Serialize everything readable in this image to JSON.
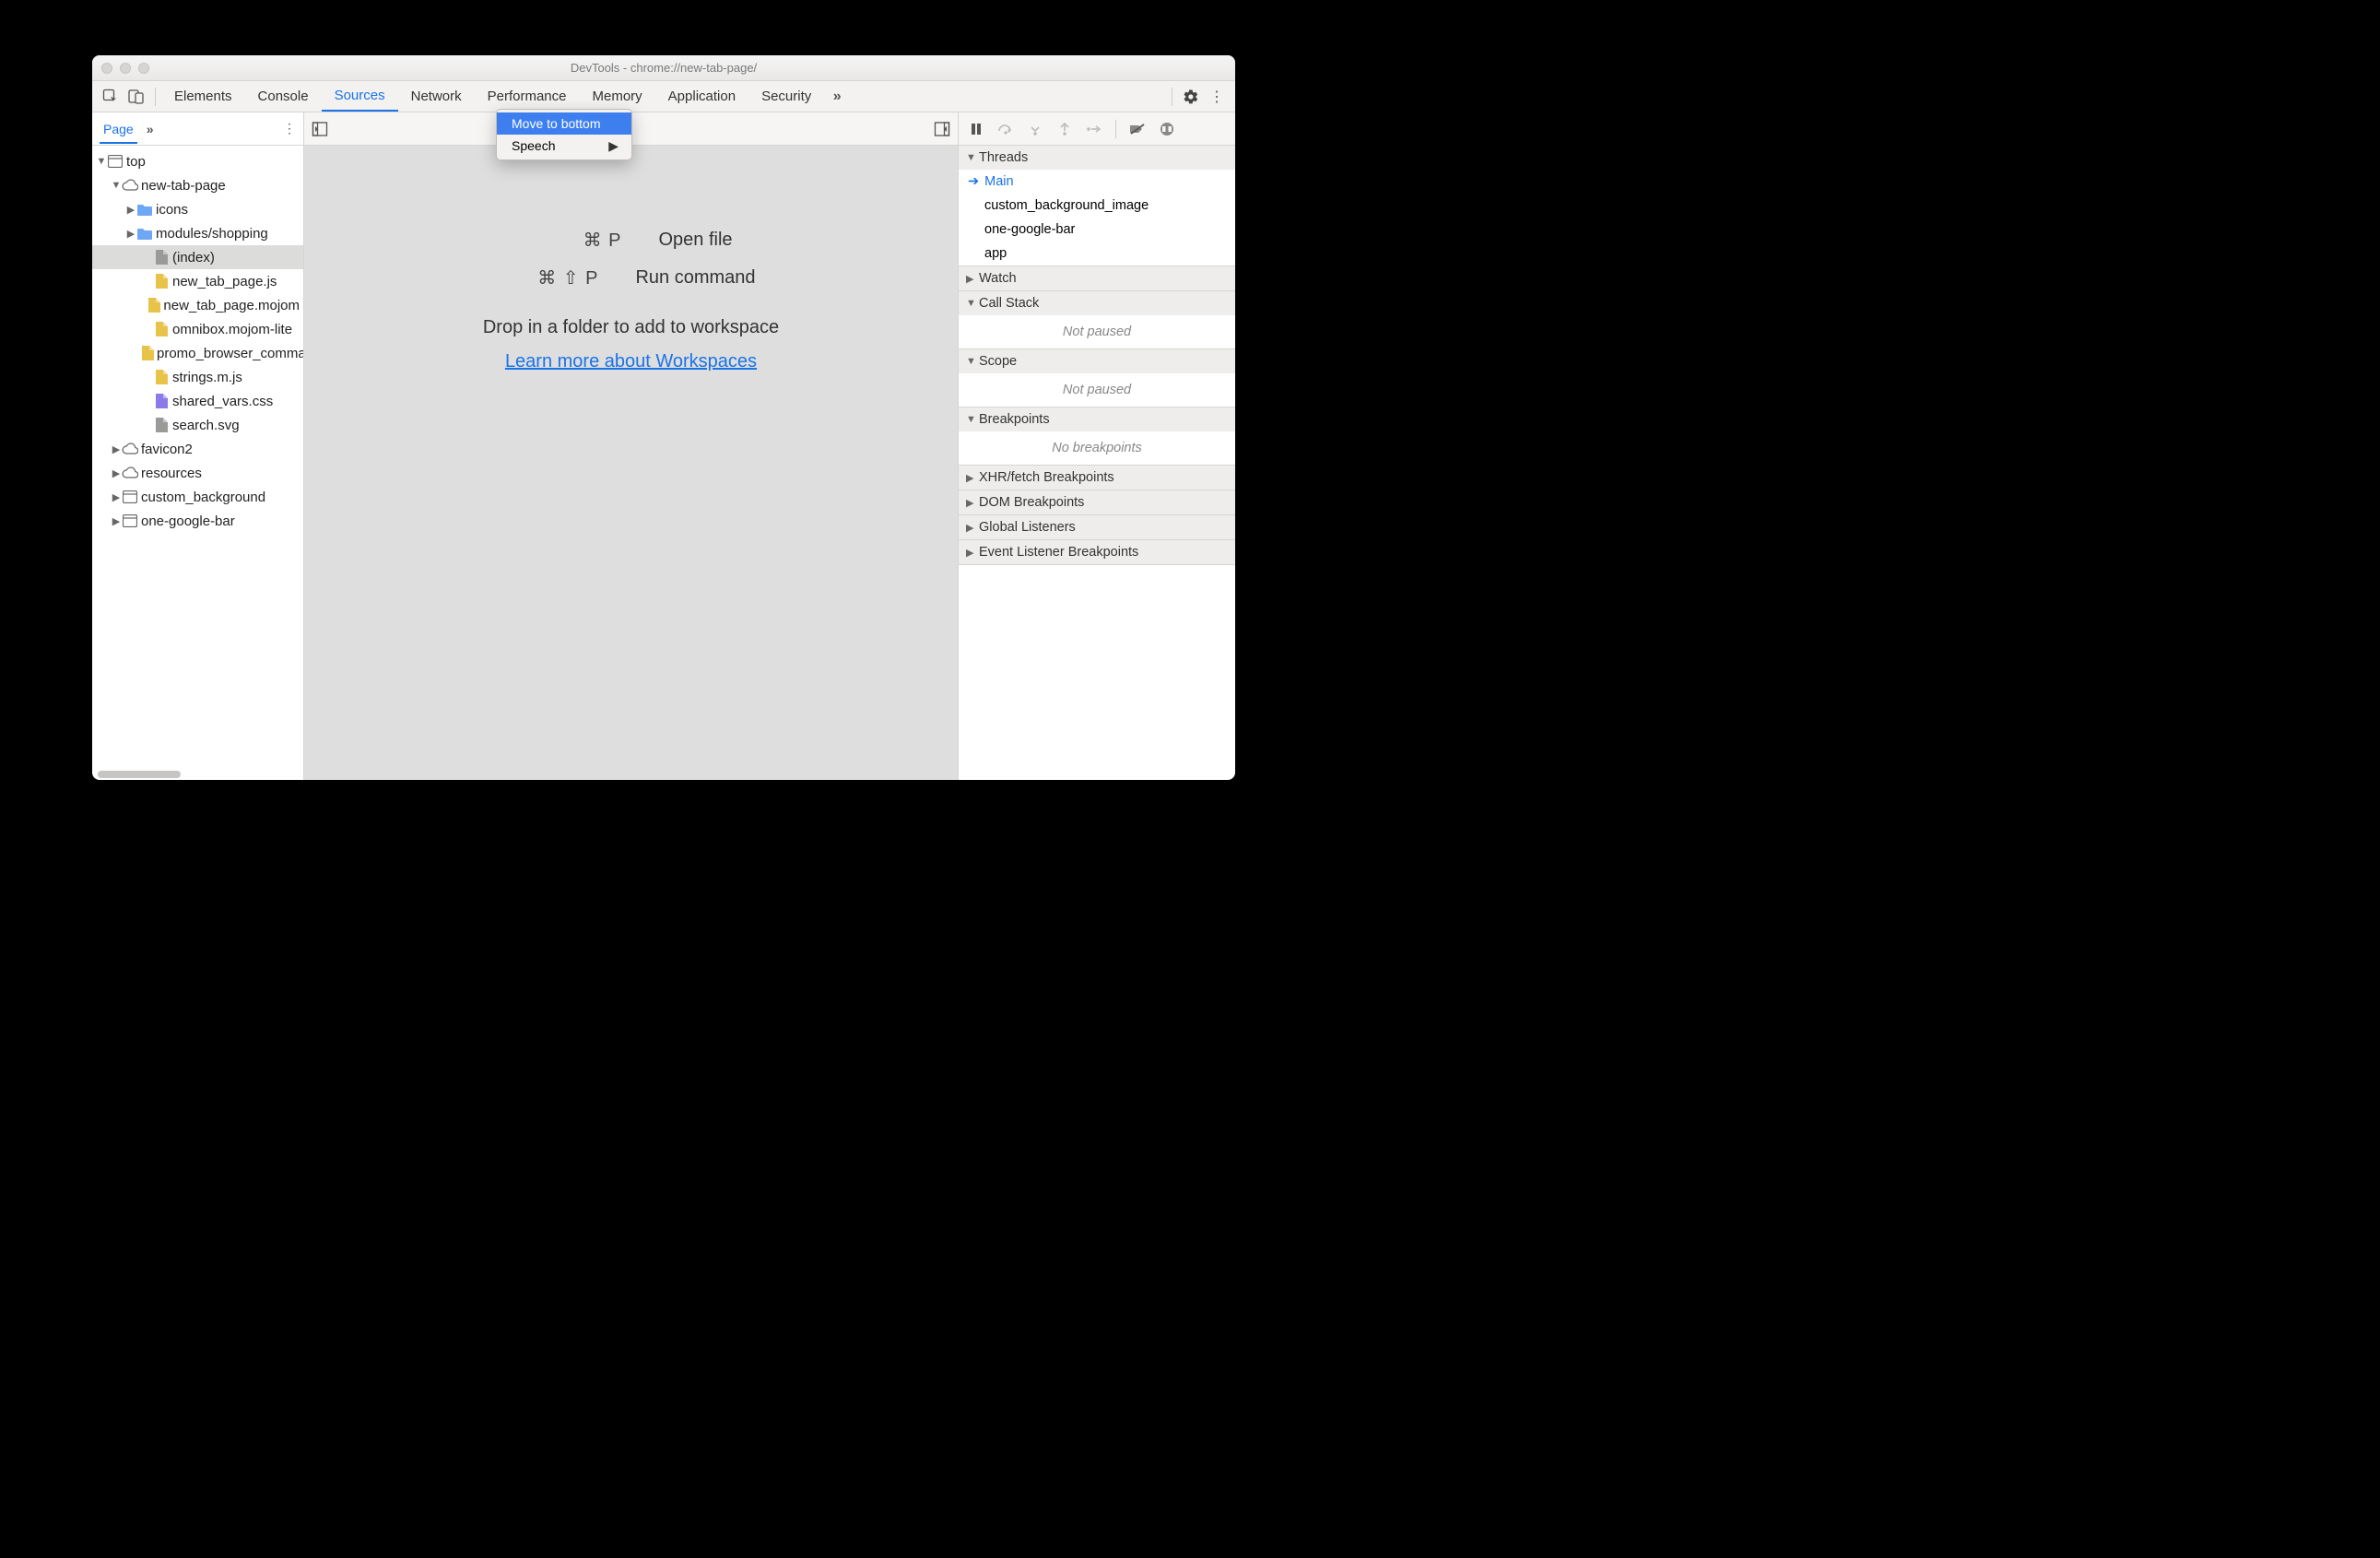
{
  "window": {
    "title": "DevTools - chrome://new-tab-page/"
  },
  "tabs": {
    "items": [
      "Elements",
      "Console",
      "Sources",
      "Network",
      "Performance",
      "Memory",
      "Application",
      "Security"
    ],
    "active": 2
  },
  "context_menu": {
    "items": [
      {
        "label": "Move to bottom",
        "highlighted": true
      },
      {
        "label": "Speech",
        "submenu": true
      }
    ]
  },
  "left": {
    "tab_label": "Page",
    "tree": [
      {
        "d": 0,
        "expand": "open",
        "icon": "frame",
        "label": "top"
      },
      {
        "d": 1,
        "expand": "open",
        "icon": "cloud",
        "label": "new-tab-page"
      },
      {
        "d": 2,
        "expand": "closed",
        "icon": "folder",
        "label": "icons"
      },
      {
        "d": 2,
        "expand": "closed",
        "icon": "folder",
        "label": "modules/shopping"
      },
      {
        "d": 3,
        "icon": "doc-gray",
        "label": "(index)",
        "selected": true
      },
      {
        "d": 3,
        "icon": "doc-yellow",
        "label": "new_tab_page.js"
      },
      {
        "d": 3,
        "icon": "doc-yellow",
        "label": "new_tab_page.mojom"
      },
      {
        "d": 3,
        "icon": "doc-yellow",
        "label": "omnibox.mojom-lite"
      },
      {
        "d": 3,
        "icon": "doc-yellow",
        "label": "promo_browser_command"
      },
      {
        "d": 3,
        "icon": "doc-yellow",
        "label": "strings.m.js"
      },
      {
        "d": 3,
        "icon": "doc-purple",
        "label": "shared_vars.css"
      },
      {
        "d": 3,
        "icon": "doc-gray",
        "label": "search.svg"
      },
      {
        "d": 1,
        "expand": "closed",
        "icon": "cloud",
        "label": "favicon2"
      },
      {
        "d": 1,
        "expand": "closed",
        "icon": "cloud",
        "label": "resources"
      },
      {
        "d": 1,
        "expand": "closed",
        "icon": "frame",
        "label": "custom_background"
      },
      {
        "d": 1,
        "expand": "closed",
        "icon": "frame",
        "label": "one-google-bar"
      }
    ]
  },
  "center": {
    "hint1_keys": "⌘ P",
    "hint1_label": "Open file",
    "hint2_keys": "⌘ ⇧ P",
    "hint2_label": "Run command",
    "drop_text": "Drop in a folder to add to workspace",
    "link_text": "Learn more about Workspaces"
  },
  "right": {
    "sections": {
      "threads": {
        "label": "Threads",
        "open": true,
        "items": [
          "Main",
          "custom_background_image",
          "one-google-bar",
          "app"
        ]
      },
      "watch": {
        "label": "Watch",
        "open": false
      },
      "callstack": {
        "label": "Call Stack",
        "open": true,
        "empty": "Not paused"
      },
      "scope": {
        "label": "Scope",
        "open": true,
        "empty": "Not paused"
      },
      "breakpoints": {
        "label": "Breakpoints",
        "open": true,
        "empty": "No breakpoints"
      },
      "xhr": {
        "label": "XHR/fetch Breakpoints",
        "open": false
      },
      "dom": {
        "label": "DOM Breakpoints",
        "open": false
      },
      "global": {
        "label": "Global Listeners",
        "open": false
      },
      "event": {
        "label": "Event Listener Breakpoints",
        "open": false
      }
    }
  }
}
